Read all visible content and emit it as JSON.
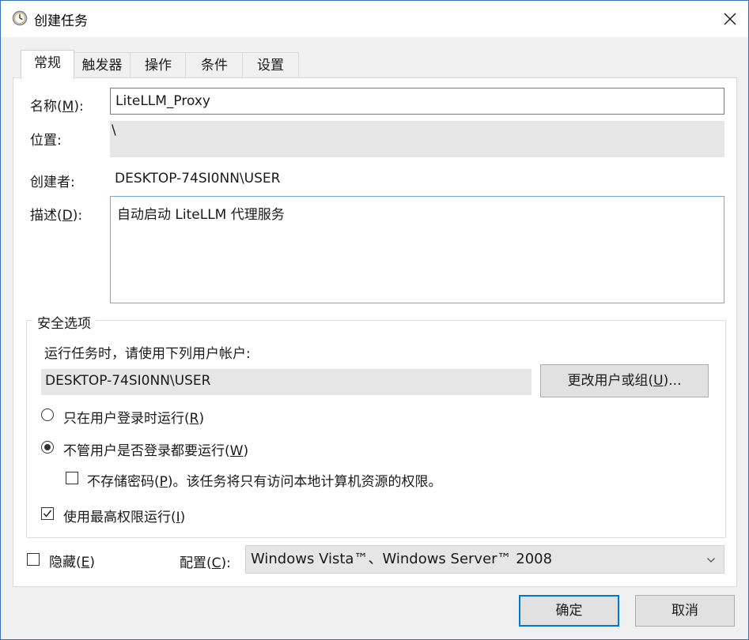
{
  "window": {
    "title": "创建任务",
    "close_glyph": "✕"
  },
  "tabs": [
    {
      "label": "常规"
    },
    {
      "label": "触发器"
    },
    {
      "label": "操作"
    },
    {
      "label": "条件"
    },
    {
      "label": "设置"
    }
  ],
  "general": {
    "name_label": "名称(",
    "name_key": "M",
    "name_label_end": "):",
    "name_value": "LiteLLM_Proxy",
    "location_label": "位置:",
    "location_value": "\\",
    "author_label": "创建者:",
    "author_value": "DESKTOP-74SI0NN\\USER",
    "description_label": "描述(",
    "description_key": "D",
    "description_label_end": "):",
    "description_value": "自动启动 LiteLLM 代理服务"
  },
  "security": {
    "group_title": "安全选项",
    "run_as_label": "运行任务时，请使用下列用户帐户:",
    "run_as_value": "DESKTOP-74SI0NN\\USER",
    "change_user_button": "更改用户或组(",
    "change_user_key": "U",
    "change_user_end": ")...",
    "radio_logged_on": "只在用户登录时运行(",
    "radio_logged_on_key": "R",
    "radio_logged_on_end": ")",
    "radio_whether_logged": "不管用户是否登录都要运行(",
    "radio_whether_logged_key": "W",
    "radio_whether_logged_end": ")",
    "no_store_password": "不存储密码(",
    "no_store_password_key": "P",
    "no_store_password_end": ")。该任务将只有访问本地计算机资源的权限。",
    "highest_privileges": "使用最高权限运行(",
    "highest_privileges_key": "I",
    "highest_privileges_end": ")",
    "whether_logged_selected": true,
    "no_store_password_checked": false,
    "highest_privileges_checked": true
  },
  "footer": {
    "hidden_label": "隐藏(",
    "hidden_key": "E",
    "hidden_end": ")",
    "hidden_checked": false,
    "config_label": "配置(",
    "config_key": "C",
    "config_end": "):",
    "config_value": "Windows Vista™、Windows Server™ 2008",
    "ok_button": "确定",
    "cancel_button": "取消"
  },
  "colors": {
    "accent": "#0078d7",
    "window_border": "#3b6fb6"
  }
}
